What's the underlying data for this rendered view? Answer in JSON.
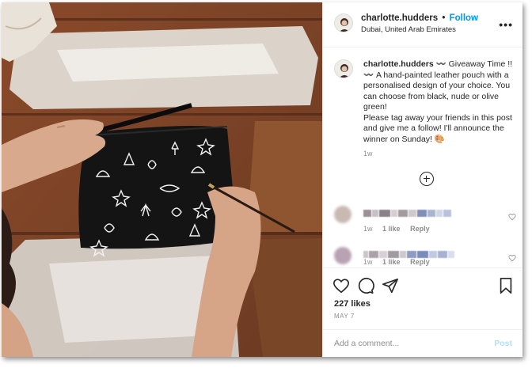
{
  "post": {
    "image_alt": "Hands painting white seashell designs on a black pouch on a wooden table"
  },
  "header": {
    "username": "charlotte.hudders",
    "separator": "•",
    "follow_label": "Follow",
    "location": "Dubai, United Arab Emirates",
    "more_label": "•••"
  },
  "caption": {
    "username": "charlotte.hudders",
    "text": " 〰️ Giveaway Time !! 〰️ A hand-painted leather pouch with a personalised design of your choice. You can choose from black, nude or olive green!",
    "text2": "Please tag away your friends in this post and give me a follow! I'll announce the winner on Sunday! 🎨",
    "time": "1w"
  },
  "comments": [
    {
      "time": "1w",
      "likes": "1 like",
      "reply": "Reply"
    },
    {
      "time": "1w",
      "likes": "1 like",
      "reply": "Reply"
    }
  ],
  "actions": {
    "likes": "227 likes",
    "date": "MAY 7"
  },
  "add_comment": {
    "placeholder": "Add a comment...",
    "post_label": "Post"
  },
  "colors": {
    "link": "#0095f6",
    "post_disabled": "#b2dffc",
    "muted": "#8e8e8e"
  }
}
